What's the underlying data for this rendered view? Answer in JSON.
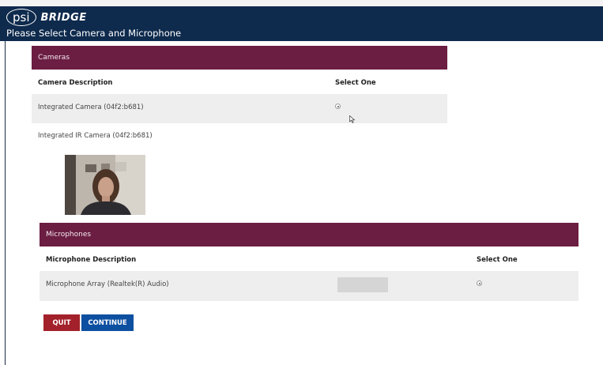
{
  "header": {
    "logo_psi": "psi",
    "logo_bridge": "BRIDGE",
    "title": "Please Select Camera and Microphone"
  },
  "cameras": {
    "section_label": "Cameras",
    "col_description": "Camera Description",
    "col_select": "Select One",
    "items": [
      {
        "label": "Integrated Camera (04f2:b681)",
        "selected": true
      },
      {
        "label": "Integrated IR Camera (04f2:b681)",
        "selected": false
      }
    ]
  },
  "microphones": {
    "section_label": "Microphones",
    "col_description": "Microphone Description",
    "col_select": "Select One",
    "items": [
      {
        "label": "Microphone Array (Realtek(R) Audio)",
        "selected": true
      }
    ]
  },
  "buttons": {
    "quit": "QUIT",
    "continue": "CONTINUE"
  },
  "colors": {
    "header_bg": "#0e2a4d",
    "section_bg": "#6b1d42",
    "quit_bg": "#a3212a",
    "continue_bg": "#0d4fa0"
  }
}
